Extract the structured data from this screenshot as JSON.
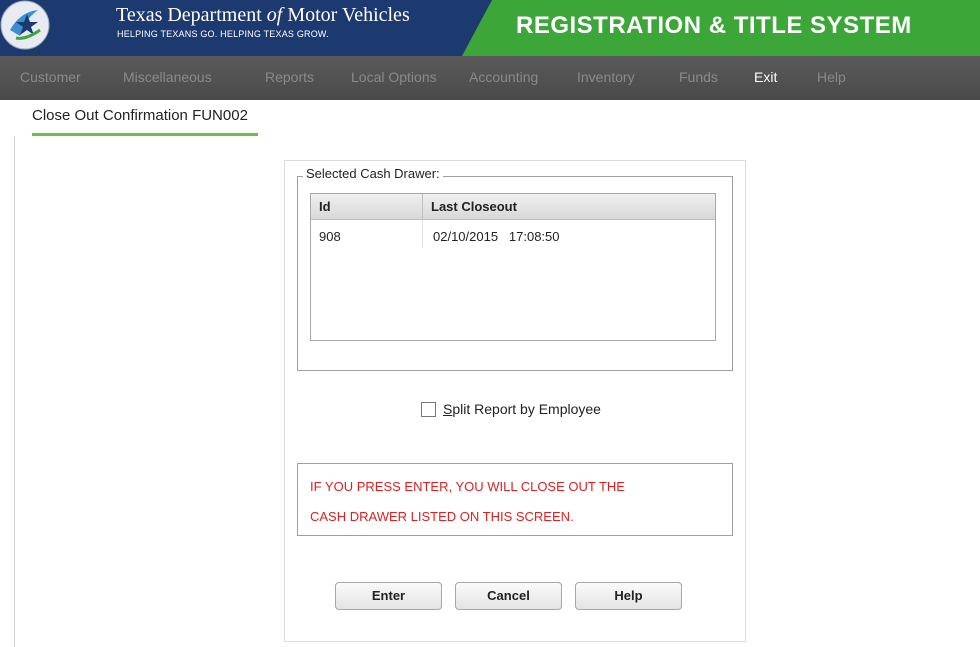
{
  "header": {
    "org_title_pre": "Texas Department ",
    "org_title_of": "of",
    "org_title_post": " Motor Vehicles",
    "org_tagline": "HELPING TEXANS GO. HELPING TEXAS GROW.",
    "system_title": "REGISTRATION & TITLE SYSTEM",
    "logo_icon": "txdmv-star-seal-icon",
    "colors": {
      "navy": "#1d3a70",
      "green": "#3da639"
    }
  },
  "menu": {
    "items": [
      {
        "label": "Customer",
        "active": false
      },
      {
        "label": "Miscellaneous",
        "active": false
      },
      {
        "label": "Reports",
        "active": false
      },
      {
        "label": "Local Options",
        "active": false
      },
      {
        "label": "Accounting",
        "active": false
      },
      {
        "label": "Inventory",
        "active": false
      },
      {
        "label": "Funds",
        "active": false
      },
      {
        "label": "Exit",
        "active": true
      },
      {
        "label": "Help",
        "active": false
      }
    ]
  },
  "page": {
    "title": "Close Out Confirmation FUN002"
  },
  "cash_drawer": {
    "legend": "Selected Cash Drawer:",
    "columns": [
      "Id",
      "Last Closeout"
    ],
    "rows": [
      {
        "id": "908",
        "last_closeout": "02/10/2015   17:08:50"
      }
    ]
  },
  "split_report": {
    "accelerator": "S",
    "rest": "plit Report by Employee",
    "checked": false
  },
  "warning": {
    "line1": "IF YOU PRESS ENTER, YOU WILL CLOSE OUT THE",
    "line2": "CASH DRAWER LISTED ON THIS SCREEN.",
    "color": "#e02020"
  },
  "buttons": {
    "enter": "Enter",
    "cancel": "Cancel",
    "help": "Help"
  }
}
